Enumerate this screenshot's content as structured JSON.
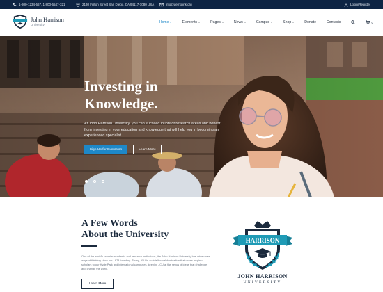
{
  "topbar": {
    "phone": "1-800-1234-567, 1-800-6547-321",
    "address": "2130 Fulton Street San Diego, CA 94117-1080 USA",
    "email": "info@demolink.org",
    "login": "Login/Register"
  },
  "header": {
    "logo_title": "John Harrison",
    "logo_sub": "University",
    "nav": [
      {
        "label": "Home"
      },
      {
        "label": "Elements"
      },
      {
        "label": "Pages"
      },
      {
        "label": "News"
      },
      {
        "label": "Campus"
      },
      {
        "label": "Shop"
      },
      {
        "label": "Donate"
      },
      {
        "label": "Contacts"
      }
    ],
    "cart_count": "0",
    "icons": [
      "search-icon",
      "cart-icon"
    ]
  },
  "hero": {
    "title_line1": "Investing in",
    "title_line2": "Knowledge.",
    "text": "At John Harrison University, you can succeed in lots of research areas and benefit from investing in your education and knowledge that will help you in becoming an experienced specialist.",
    "btn_primary": "Sign Up for Excursion",
    "btn_secondary": "Learn More",
    "slides": 3,
    "active_slide": 1
  },
  "about": {
    "title_line1": "A Few Words",
    "title_line2": "About the University",
    "text": "One of the world's premier academic and research institutions, the John Harrison University has driven new ways of thinking since our 1878 founding. Today, JCU is an intellectual destination that draws inspired scholars to our Hyde Park and international campuses, keeping JCU at the nexus of ideas that challenge and change the world.",
    "btn": "Learn More",
    "crest_banner": "HARRISON",
    "crest_name": "JOHN HARRISON",
    "crest_sub": "UNIVERSITY"
  },
  "colors": {
    "navy": "#0d2444",
    "accent": "#1e88c8",
    "teal": "#1f9bb6"
  }
}
